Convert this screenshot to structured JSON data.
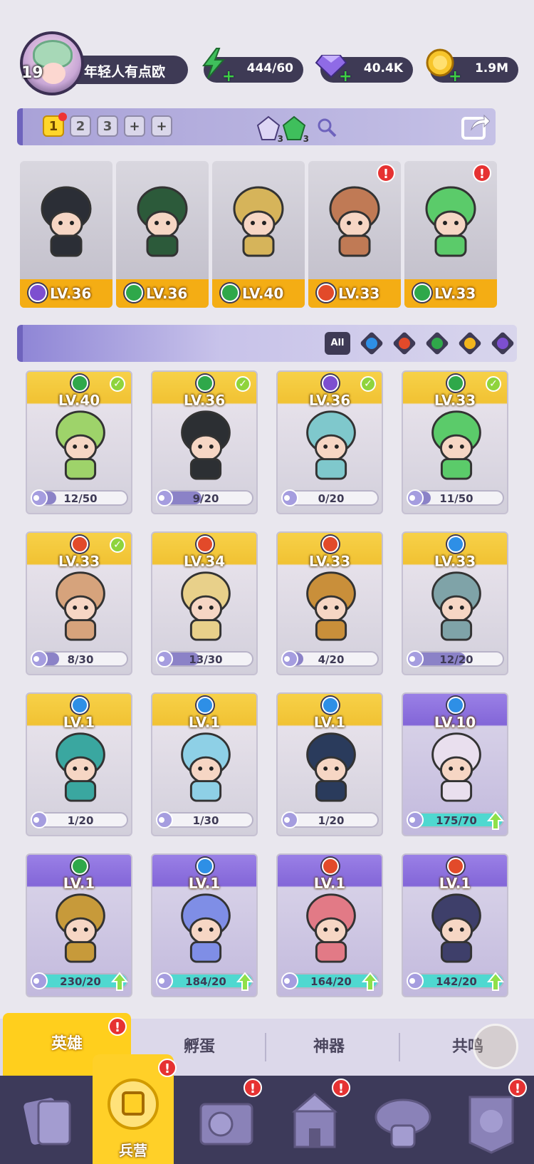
{
  "player": {
    "level": "19",
    "name": "年轻人有点欧"
  },
  "resources": [
    {
      "name": "energy",
      "icon": "lightning-icon",
      "value": "444/60",
      "color": "#3fbf5c"
    },
    {
      "name": "gems",
      "icon": "diamond-icon",
      "value": "40.4K",
      "color": "#7b5bd8"
    },
    {
      "name": "gold",
      "icon": "coin-icon",
      "value": "1.9M",
      "color": "#f2b51c"
    }
  ],
  "team": {
    "tabs": [
      "1",
      "2",
      "3"
    ],
    "active_tab": "1",
    "extra_slots": 2,
    "gem_counts": [
      "3",
      "3"
    ],
    "heroes": [
      {
        "level": "LV.36",
        "element": "dark",
        "alert": false
      },
      {
        "level": "LV.36",
        "element": "nature",
        "alert": false
      },
      {
        "level": "LV.40",
        "element": "nature",
        "alert": false
      },
      {
        "level": "LV.33",
        "element": "fire",
        "alert": true
      },
      {
        "level": "LV.33",
        "element": "nature",
        "alert": true
      }
    ]
  },
  "filters": {
    "all_label": "All",
    "elements": [
      "water",
      "fire",
      "nature",
      "light",
      "dark"
    ]
  },
  "element_colors": {
    "water": "#2e8fe6",
    "fire": "#e24a2a",
    "nature": "#2fa84a",
    "light": "#f2b51c",
    "dark": "#7d4fd0"
  },
  "heroes": [
    {
      "level": "LV.40",
      "element": "nature",
      "progress": "12/50",
      "ratio": 0.24,
      "deployed": true,
      "rarity": "gold",
      "art": "#9ed36a"
    },
    {
      "level": "LV.36",
      "element": "nature",
      "progress": "9/20",
      "ratio": 0.45,
      "deployed": true,
      "rarity": "gold",
      "art": "#2c2f33"
    },
    {
      "level": "LV.36",
      "element": "dark",
      "progress": "0/20",
      "ratio": 0.0,
      "deployed": true,
      "rarity": "gold",
      "art": "#7fc8cc"
    },
    {
      "level": "LV.33",
      "element": "nature",
      "progress": "11/50",
      "ratio": 0.22,
      "deployed": true,
      "rarity": "gold",
      "art": "#5bcb6a"
    },
    {
      "level": "LV.33",
      "element": "fire",
      "progress": "8/30",
      "ratio": 0.27,
      "deployed": true,
      "rarity": "gold",
      "art": "#d6a37c"
    },
    {
      "level": "LV.34",
      "element": "fire",
      "progress": "13/30",
      "ratio": 0.43,
      "deployed": false,
      "rarity": "gold",
      "art": "#e8d08a"
    },
    {
      "level": "LV.33",
      "element": "fire",
      "progress": "4/20",
      "ratio": 0.2,
      "deployed": false,
      "rarity": "gold",
      "art": "#c98f3a"
    },
    {
      "level": "LV.33",
      "element": "water",
      "progress": "12/20",
      "ratio": 0.6,
      "deployed": false,
      "rarity": "gold",
      "art": "#7fa3a8"
    },
    {
      "level": "LV.1",
      "element": "water",
      "progress": "1/20",
      "ratio": 0.05,
      "deployed": false,
      "rarity": "gold",
      "art": "#3aa7a0"
    },
    {
      "level": "LV.1",
      "element": "water",
      "progress": "1/30",
      "ratio": 0.03,
      "deployed": false,
      "rarity": "gold",
      "art": "#8ed0e6"
    },
    {
      "level": "LV.1",
      "element": "water",
      "progress": "1/20",
      "ratio": 0.05,
      "deployed": false,
      "rarity": "gold",
      "art": "#2a3b5c"
    },
    {
      "level": "LV.10",
      "element": "water",
      "progress": "175/70",
      "ratio": 1.0,
      "deployed": false,
      "rarity": "purple",
      "art": "#e9dfee",
      "upgrade": true
    },
    {
      "level": "LV.1",
      "element": "nature",
      "progress": "230/20",
      "ratio": 1.0,
      "deployed": false,
      "rarity": "purple",
      "art": "#c79a3a",
      "upgrade": true
    },
    {
      "level": "LV.1",
      "element": "water",
      "progress": "184/20",
      "ratio": 1.0,
      "deployed": false,
      "rarity": "purple",
      "art": "#7f8ee6",
      "upgrade": true
    },
    {
      "level": "LV.1",
      "element": "fire",
      "progress": "164/20",
      "ratio": 1.0,
      "deployed": false,
      "rarity": "purple",
      "art": "#e27a86",
      "upgrade": true
    },
    {
      "level": "LV.1",
      "element": "fire",
      "progress": "142/20",
      "ratio": 1.0,
      "deployed": false,
      "rarity": "purple",
      "art": "#3e3f6a",
      "upgrade": true
    }
  ],
  "subtabs": [
    {
      "label": "英雄",
      "active": true,
      "alert": true
    },
    {
      "label": "孵蛋",
      "active": false,
      "alert": false
    },
    {
      "label": "神器",
      "active": false,
      "alert": false
    },
    {
      "label": "共鸣",
      "active": false,
      "alert": false
    }
  ],
  "nav": [
    {
      "icon": "cards-icon",
      "label": "",
      "alert": false
    },
    {
      "icon": "barracks-icon",
      "label": "兵营",
      "alert": true,
      "active": true
    },
    {
      "icon": "map-book-icon",
      "label": "",
      "alert": true
    },
    {
      "icon": "castle-icon",
      "label": "",
      "alert": true
    },
    {
      "icon": "mushroom-house-icon",
      "label": "",
      "alert": false
    },
    {
      "icon": "guild-banner-icon",
      "label": "",
      "alert": true
    }
  ]
}
